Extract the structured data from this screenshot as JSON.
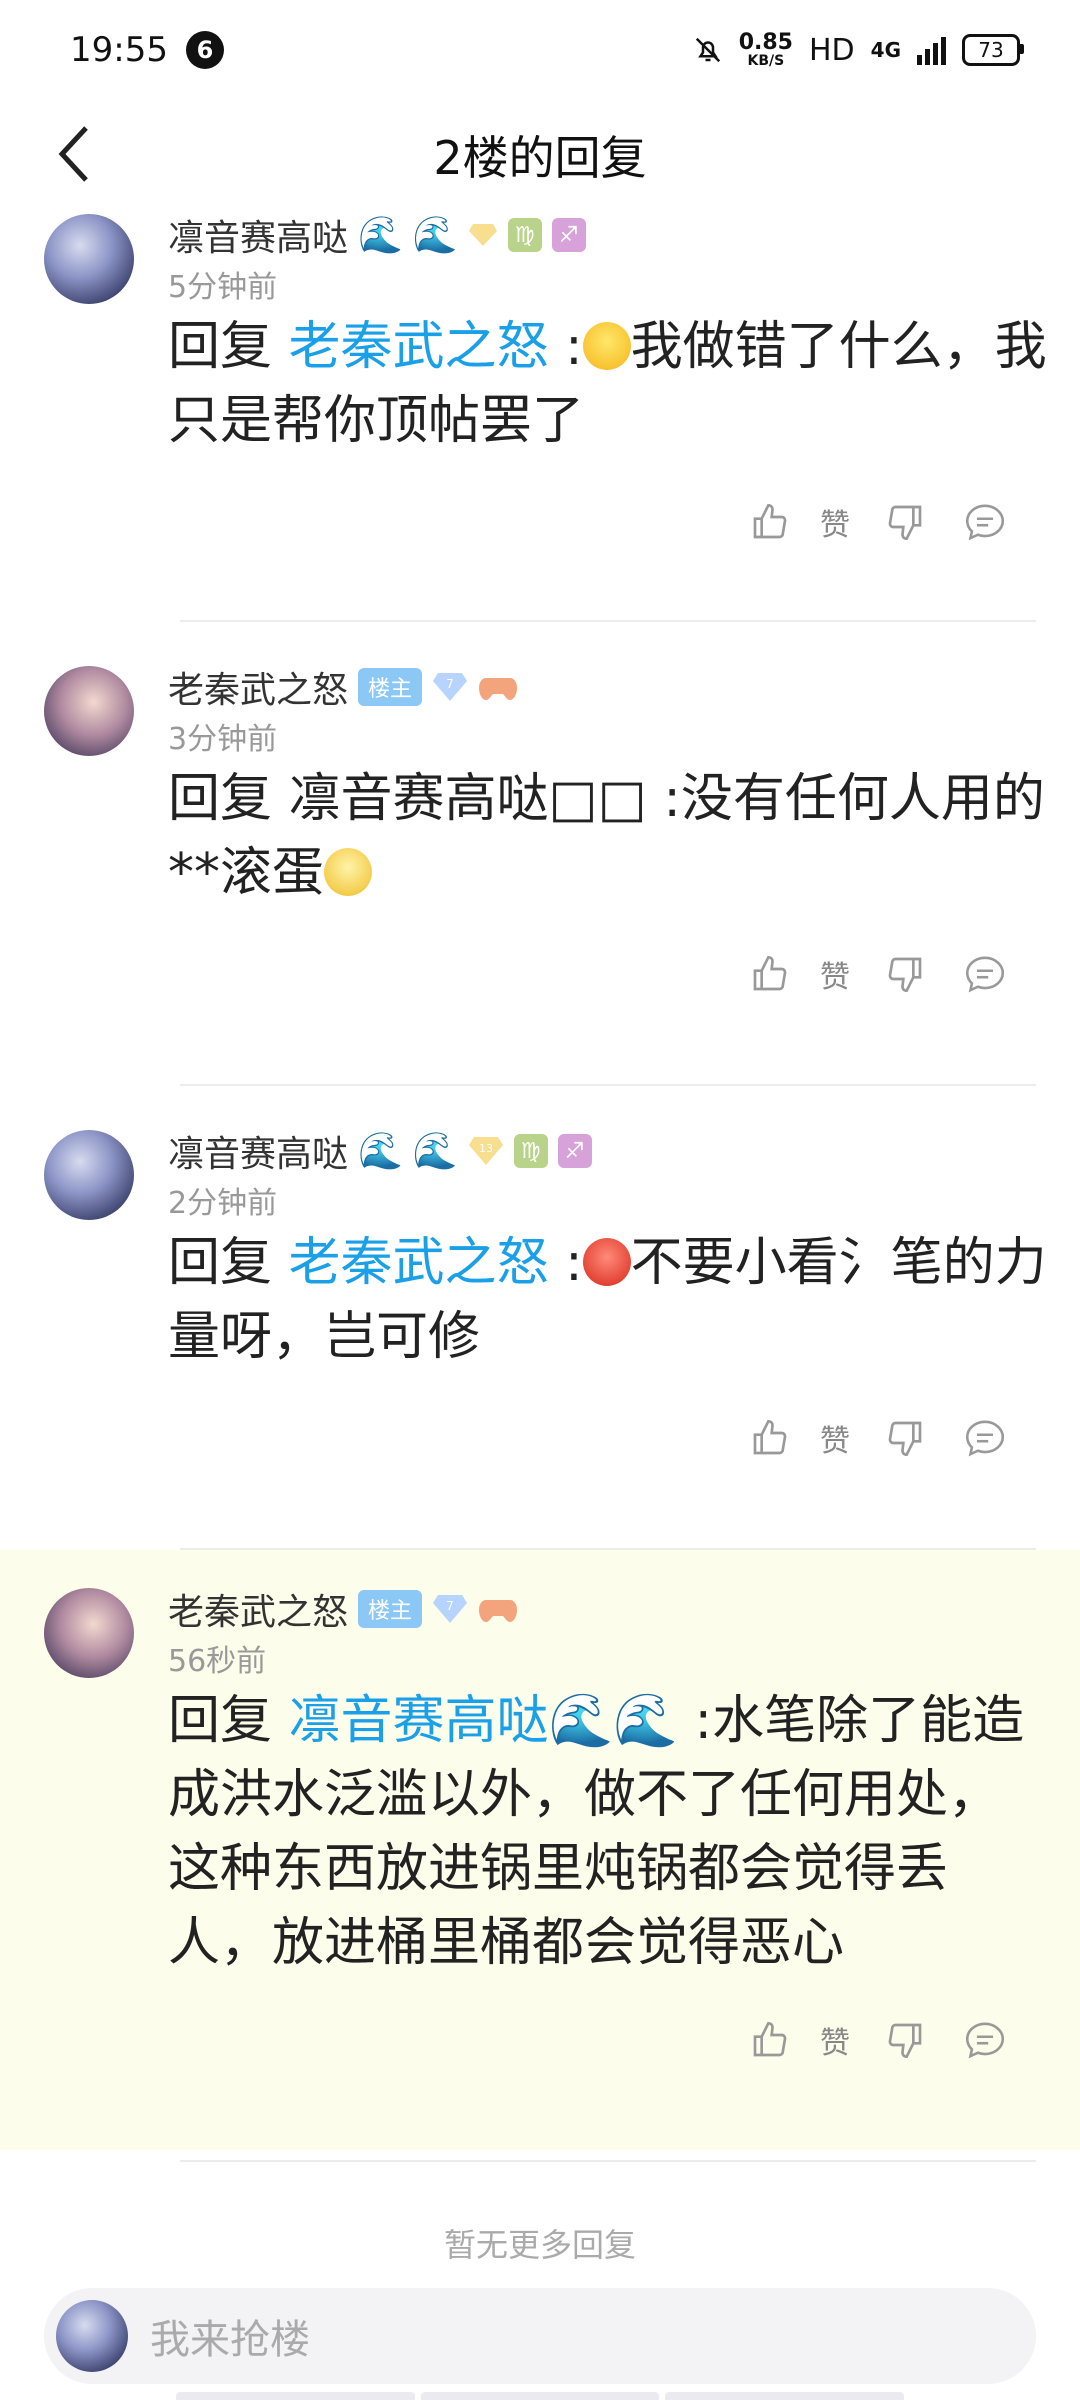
{
  "status_bar": {
    "time": "19:55",
    "notification_count": "6",
    "net_speed_value": "0.85",
    "net_speed_unit": "KB/S",
    "hd_label": "HD",
    "network_label": "4G",
    "battery": "73"
  },
  "nav": {
    "title": "2楼的回复"
  },
  "replies": [
    {
      "username": "凛音赛高哒",
      "timestamp": "5分钟前",
      "text_prefix": "回复 ",
      "mention": "老秦武之怒",
      "text_suffix_before_emoji": " :",
      "text_after_emoji": "我做错了什么，我只是帮你顶帖罢了",
      "like_label": "赞"
    },
    {
      "username": "老秦武之怒",
      "owner_badge": "楼主",
      "level": "7",
      "timestamp": "3分钟前",
      "text_before_emoji": "回复 凛音赛高哒□□ :没有任何人用的**滚蛋",
      "like_label": "赞"
    },
    {
      "username": "凛音赛高哒",
      "level": "13",
      "timestamp": "2分钟前",
      "text_prefix": "回复 ",
      "mention": "老秦武之怒",
      "text_suffix_before_emoji": " :",
      "text_after_emoji": "不要小看氵笔的力量呀，岂可修",
      "like_label": "赞"
    },
    {
      "username": "老秦武之怒",
      "owner_badge": "楼主",
      "level": "7",
      "timestamp": "56秒前",
      "text_prefix": "回复 ",
      "mention": "凛音赛高哒🌊🌊",
      "text_rest": " :水笔除了能造成洪水泛滥以外，做不了任何用处，这种东西放进锅里炖锅都会觉得丢人，放进桶里桶都会觉得恶心",
      "like_label": "赞"
    }
  ],
  "footer": {
    "no_more": "暂无更多回复",
    "input_placeholder": "我来抢楼"
  },
  "icons": {
    "back": "chevron-left-icon",
    "like": "thumbs-up-icon",
    "dislike": "thumbs-down-icon",
    "comment": "comment-bubble-icon"
  },
  "colors": {
    "mention": "#1aa0e8",
    "highlight_bg": "#fdfdeb",
    "owner_badge": "#8cc8f5"
  }
}
